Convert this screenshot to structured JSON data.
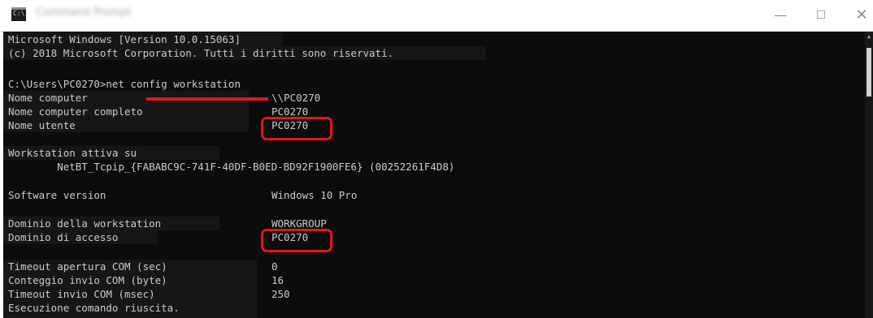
{
  "window": {
    "title": "Command Prompt",
    "controls": {
      "minimize": "—",
      "maximize": "☐",
      "close": "✕"
    },
    "icon": "cmd-icon"
  },
  "console": {
    "header": [
      "Microsoft Windows [Version 10.0.15063]",
      "(c) 2018 Microsoft Corporation. Tutti i diritti sono riservati."
    ],
    "command": "C:\\Users\\PC0270>net config workstation",
    "rows": [
      {
        "label": "Nome computer",
        "value": "\\\\PC0270"
      },
      {
        "label": "Nome computer completo",
        "value": "PC0270"
      },
      {
        "label": "Nome utente",
        "value": "PC0270"
      },
      {
        "label": "Workstation attiva su",
        "value": ""
      },
      {
        "label": "        NetBT_Tcpip_{FABABC9C-741F-40DF-B0ED-BD92F1900FE6} (00252261F4D8)",
        "value": ""
      },
      {
        "label": "Software version",
        "value": "Windows 10 Pro"
      },
      {
        "label": "Dominio della workstation",
        "value": "WORKGROUP"
      },
      {
        "label": "Dominio di accesso",
        "value": "PC0270"
      },
      {
        "label": "Timeout apertura COM (sec)",
        "value": "0"
      },
      {
        "label": "Conteggio invio COM (byte)",
        "value": "16"
      },
      {
        "label": "Timeout invio COM (msec)",
        "value": "250"
      }
    ],
    "footer": "Esecuzione comando riuscita."
  },
  "colors": {
    "console_bg": "#0c0c0c",
    "console_text": "#cccccc",
    "annotation_red": "#e5141c"
  }
}
